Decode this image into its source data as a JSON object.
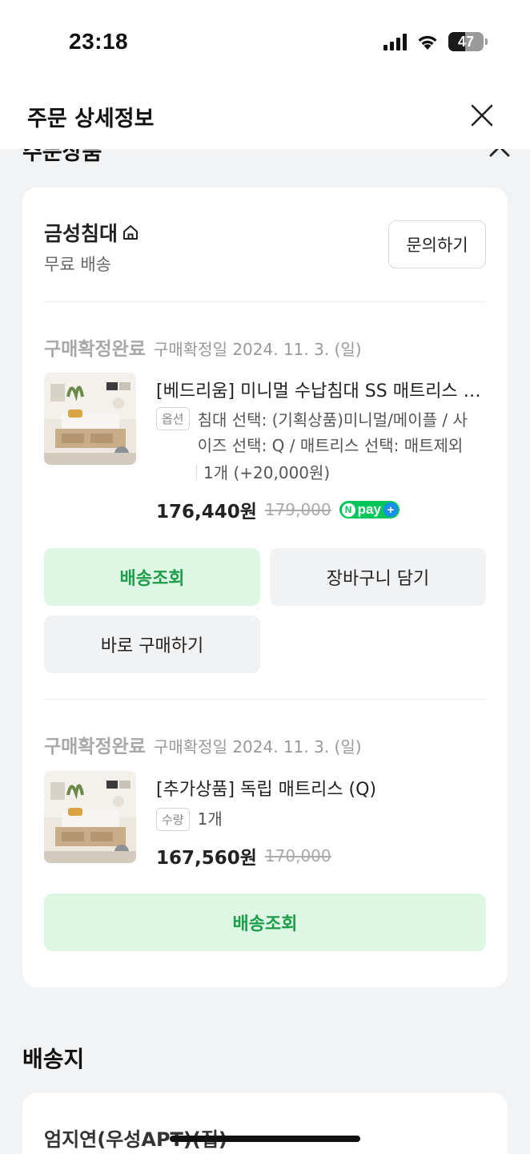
{
  "status_bar": {
    "time": "23:18",
    "battery": "47"
  },
  "header": {
    "title": "주문 상세정보"
  },
  "section": {
    "title": "주문상품"
  },
  "seller": {
    "name": "금성침대",
    "shipping": "무료 배송",
    "inquiry_label": "문의하기"
  },
  "items": [
    {
      "status": "구매확정완료",
      "date": "구매확정일 2024. 11. 3. (일)",
      "name": "[베드리움] 미니멀 수납침대 SS 매트리스 세트",
      "tag": "옵션",
      "option_line1": "침대 선택: (기획상품)미니멀/메이플 / 사",
      "option_line2": "이즈 선택: Q / 매트리스 선택: 매트제외",
      "quantity": "1개 (+20,000원)",
      "price": "176,440원",
      "original_price": "179,000",
      "pay_badge": "pay",
      "buttons": {
        "track": "배송조회",
        "cart": "장바구니 담기",
        "buy_now": "바로 구매하기"
      }
    },
    {
      "status": "구매확정완료",
      "date": "구매확정일 2024. 11. 3. (일)",
      "name": "[추가상품] 독립 매트리스 (Q)",
      "tag": "수량",
      "quantity": "1개",
      "price": "167,560원",
      "original_price": "170,000",
      "buttons": {
        "track": "배송조회"
      }
    }
  ],
  "delivery": {
    "title": "배송지",
    "recipient": "엄지연(우성APT)(집)"
  },
  "colors": {
    "accent_green": "#1e9d4a",
    "green_bg": "#def7e5",
    "npay": "#03c75a"
  }
}
